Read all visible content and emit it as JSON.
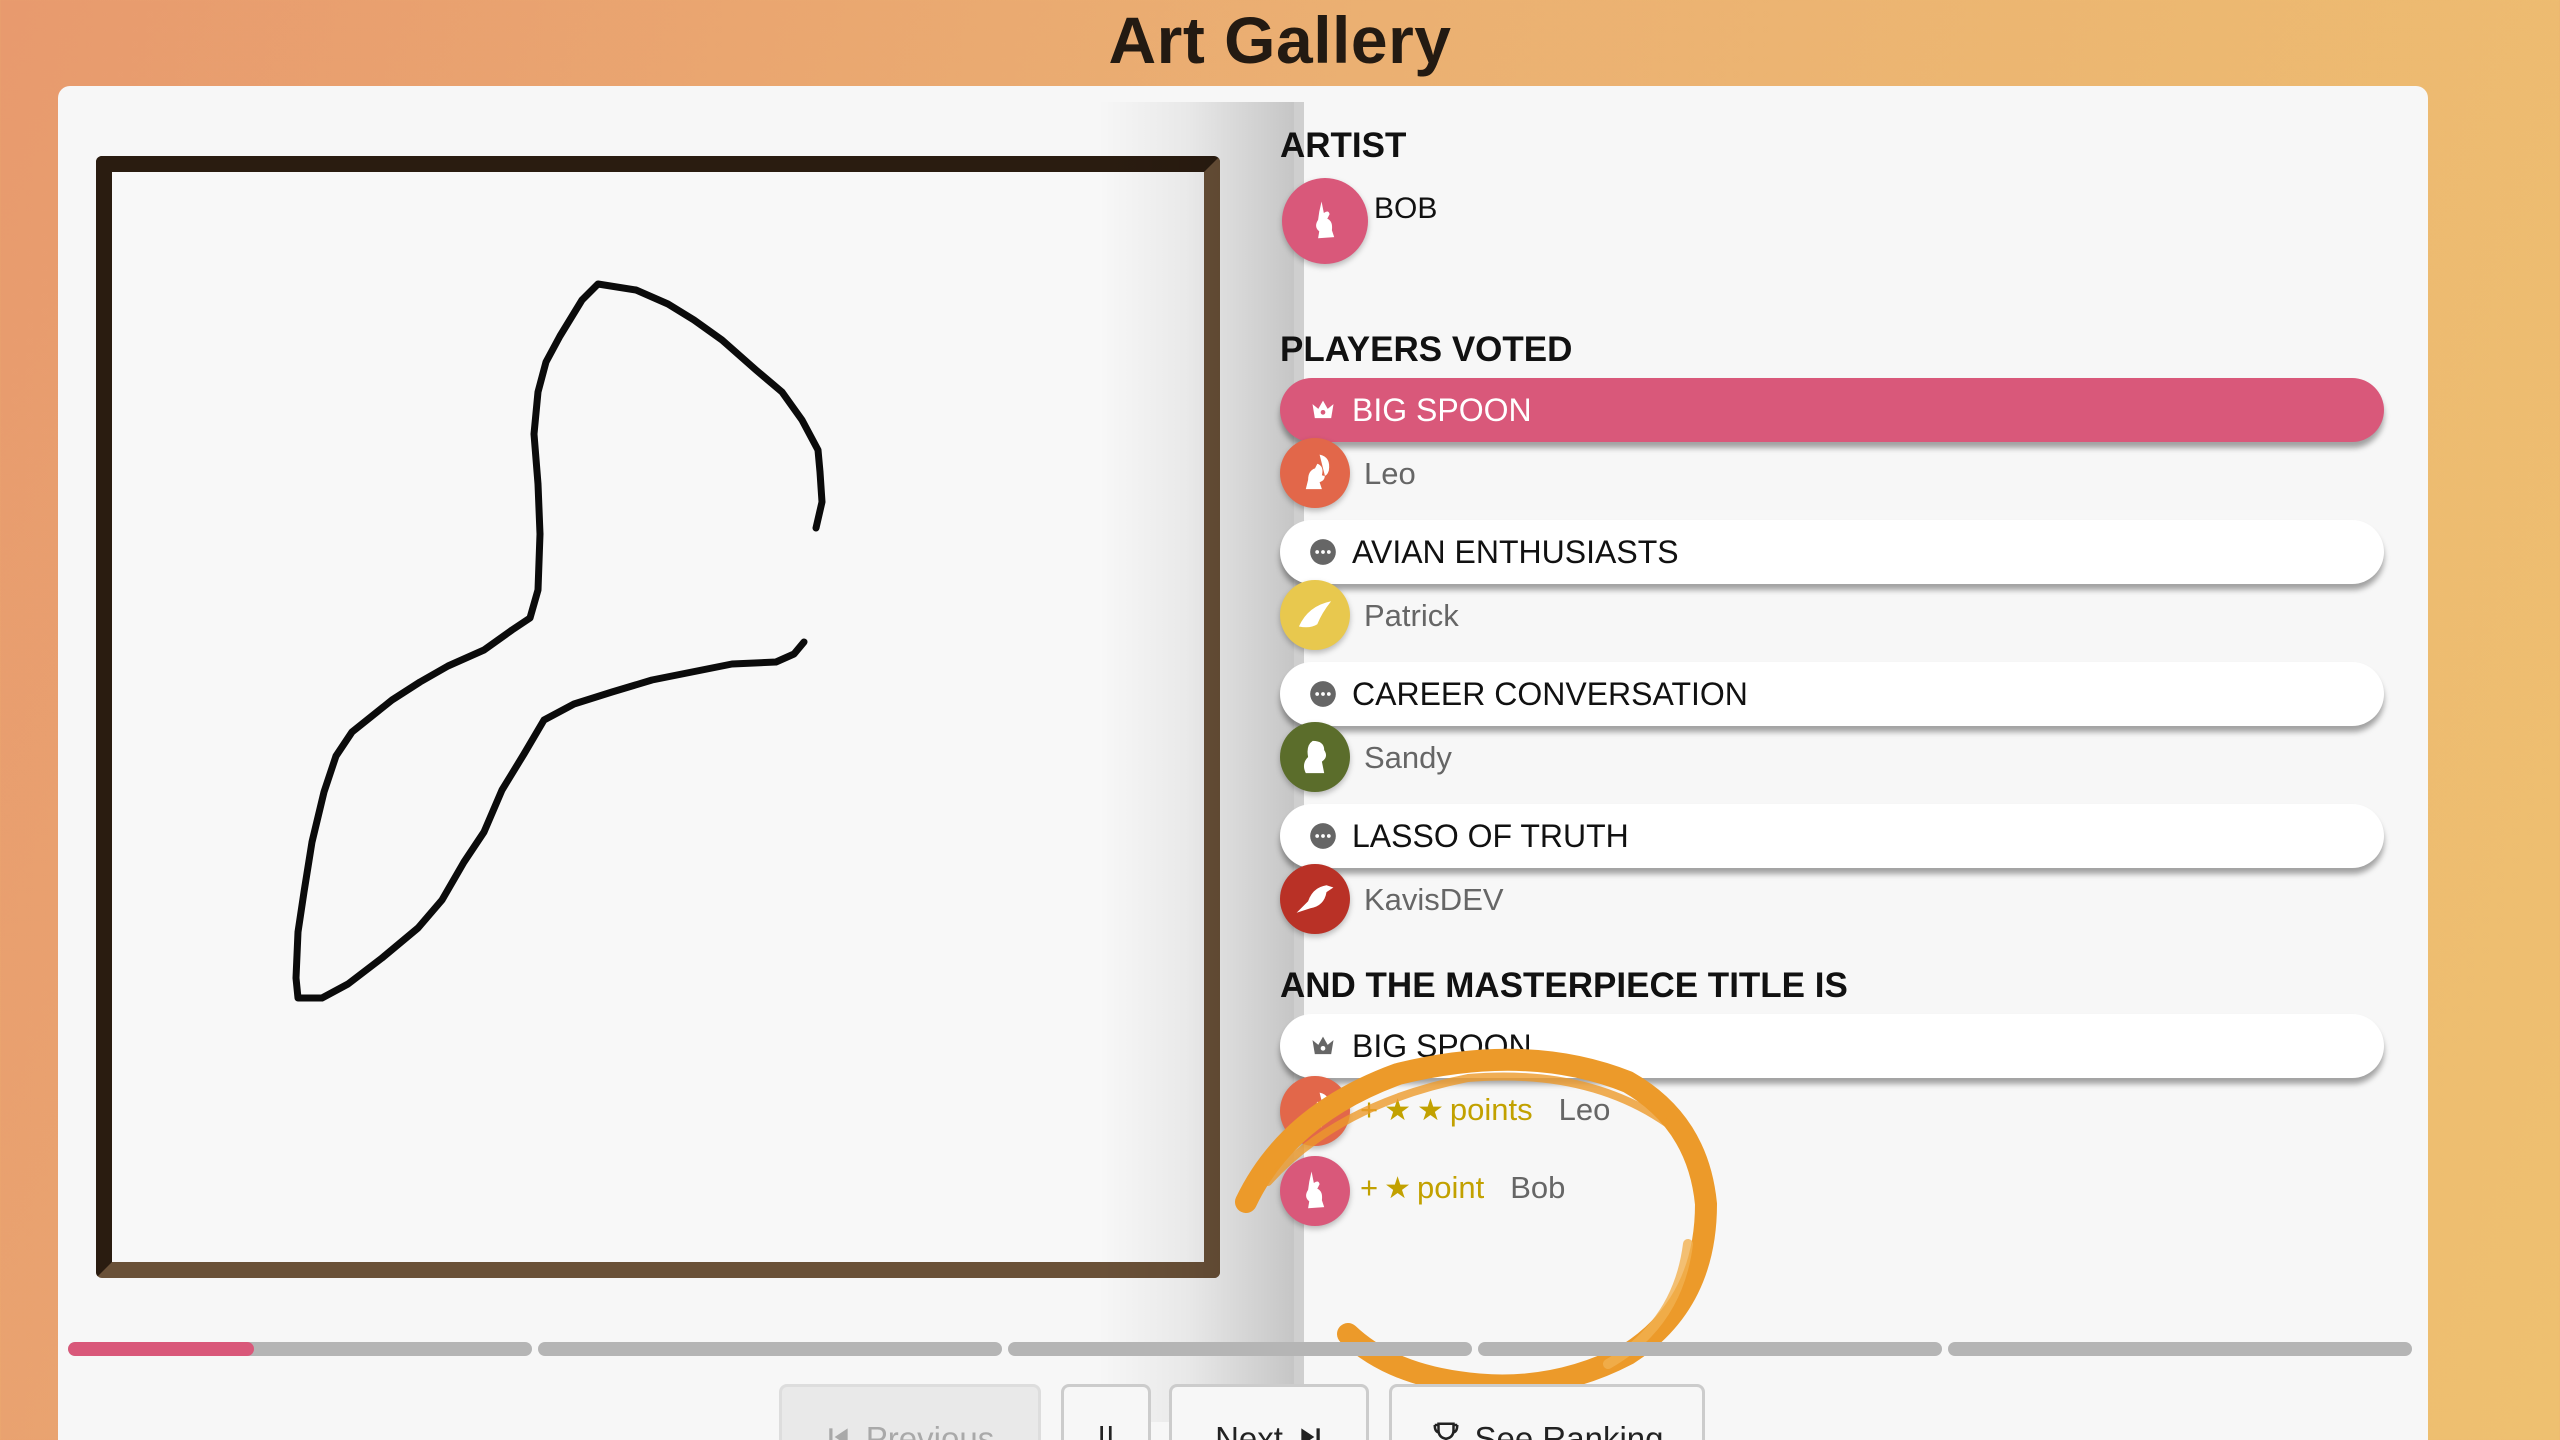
{
  "header": {
    "title": "Art Gallery"
  },
  "artist": {
    "section_label": "ARTIST",
    "name": "BOB",
    "avatar_color": "#d9587a",
    "avatar_icon": "rabbit-icon"
  },
  "votes": {
    "section_label": "PLAYERS VOTED",
    "items": [
      {
        "title": "BIG SPOON",
        "icon": "crown-icon",
        "is_winner": true,
        "voter": "Leo",
        "voter_avatar_color": "#e2674a",
        "voter_avatar_icon": "squirrel-icon"
      },
      {
        "title": "AVIAN ENTHUSIASTS",
        "icon": "chat-icon",
        "is_winner": false,
        "voter": "Patrick",
        "voter_avatar_color": "#e8c84e",
        "voter_avatar_icon": "bird-icon"
      },
      {
        "title": "CAREER CONVERSATION",
        "icon": "chat-icon",
        "is_winner": false,
        "voter": "Sandy",
        "voter_avatar_color": "#5b6d2b",
        "voter_avatar_icon": "beaver-icon"
      },
      {
        "title": "LASSO OF TRUTH",
        "icon": "chat-icon",
        "is_winner": false,
        "voter": "KavisDEV",
        "voter_avatar_color": "#b93126",
        "voter_avatar_icon": "crow-icon"
      }
    ]
  },
  "result": {
    "section_label": "AND THE MASTERPIECE TITLE IS",
    "title": "BIG SPOON",
    "awards": [
      {
        "plus": "+",
        "stars": 2,
        "points_label": "points",
        "player": "Leo",
        "avatar_color": "#e2674a"
      },
      {
        "plus": "+",
        "stars": 1,
        "points_label": "point",
        "player": "Bob",
        "avatar_color": "#d9587a"
      }
    ]
  },
  "progress": {
    "segments": 5,
    "current_segment_fill": 0.4
  },
  "controls": {
    "previous_label": "Previous",
    "pause_label": "||",
    "next_label": "Next",
    "ranking_label": "See Ranking"
  },
  "colors": {
    "accent": "#d9587a",
    "highlight": "#ec9a2a",
    "gold": "#c2a100"
  }
}
